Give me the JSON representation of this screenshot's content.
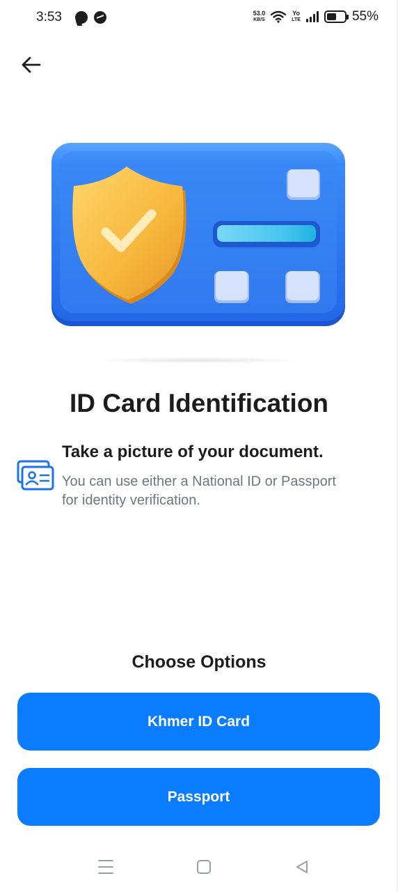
{
  "status_bar": {
    "time": "3:53",
    "net_speed_value": "53.0",
    "net_speed_unit": "KB/S",
    "volte_top": "Yo",
    "volte_bottom": "LTE",
    "battery_level": 0.55,
    "battery_percent": "55%"
  },
  "hero": {
    "card_color": "#2f7bf2",
    "shield_color": "#f6b73c",
    "accent_color": "#22c3e6"
  },
  "page": {
    "title": "ID Card Identification",
    "instruction_heading": "Take a picture of your document.",
    "instruction_desc": "You can use either a National ID or Passport for identity verification."
  },
  "options": {
    "title": "Choose Options",
    "buttons": [
      {
        "label": "Khmer ID Card"
      },
      {
        "label": "Passport"
      }
    ],
    "button_color": "#0a7cff"
  },
  "icons": {
    "back": "arrow-left-icon",
    "document": "id-card-icon",
    "nav_menu": "menu-icon",
    "nav_home": "home-square-icon",
    "nav_back": "triangle-back-icon"
  }
}
